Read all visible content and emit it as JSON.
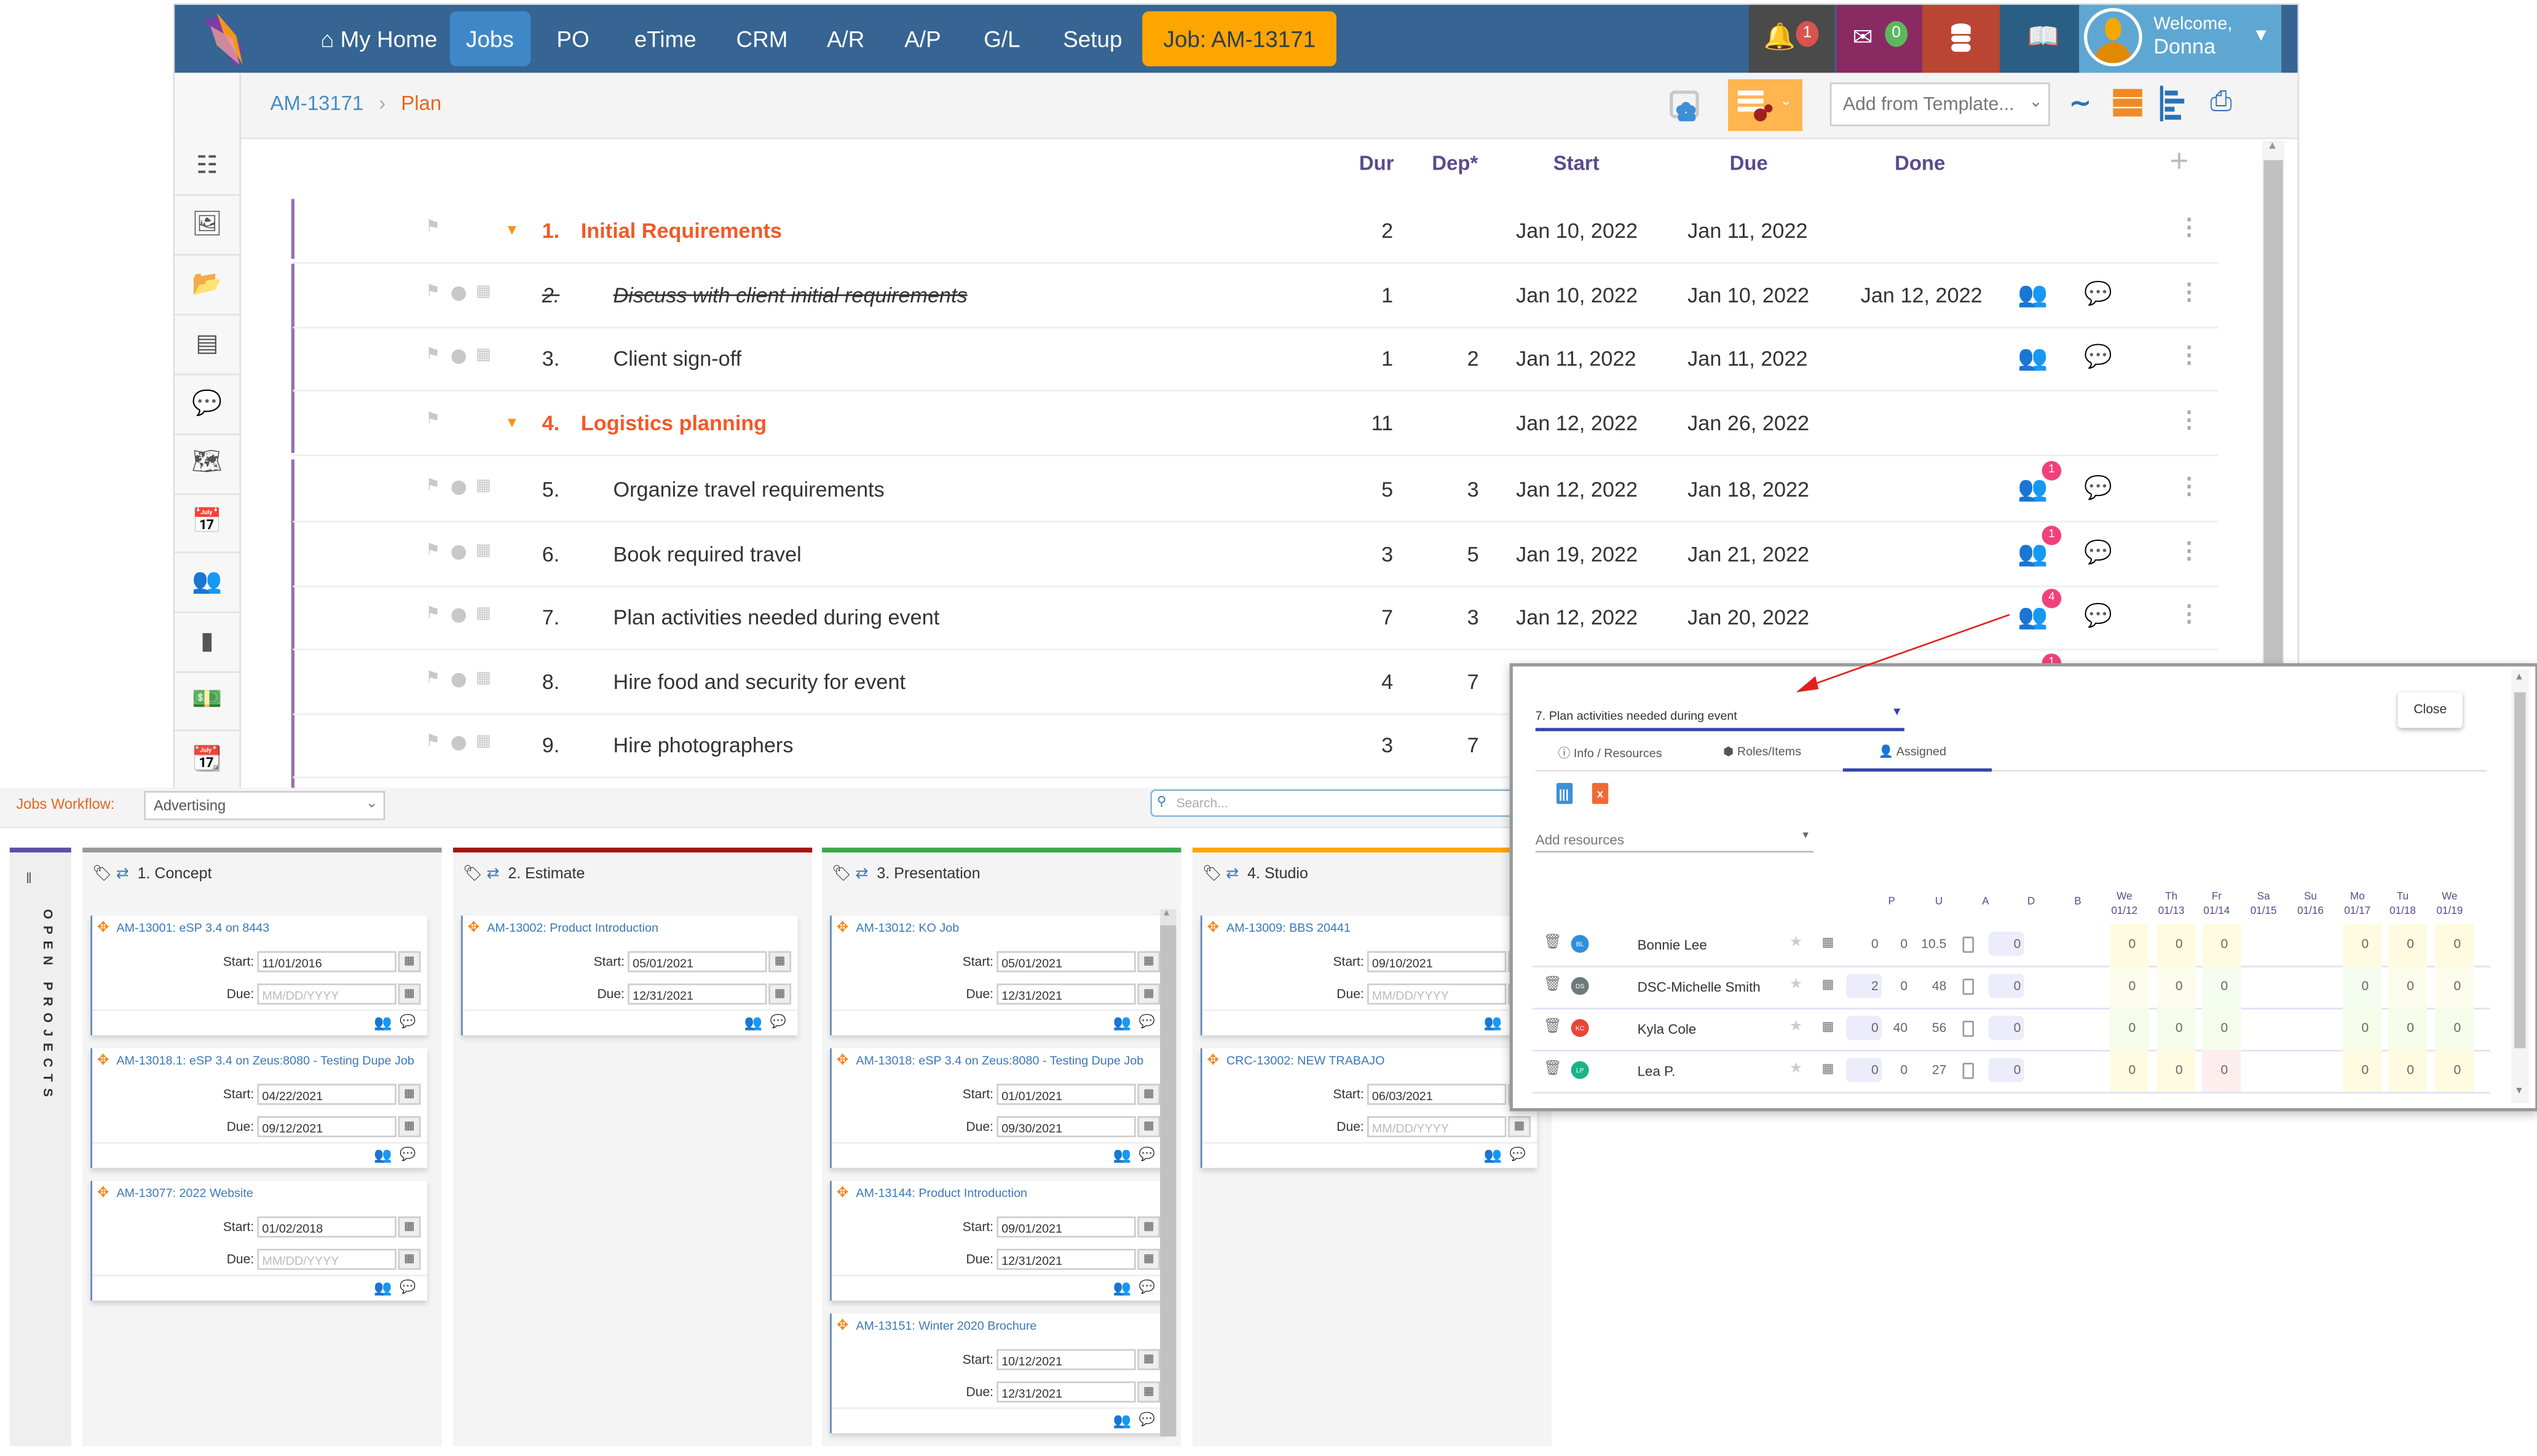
{
  "nav": {
    "items": [
      {
        "label": "My Home",
        "icon": "home-icon"
      },
      {
        "label": "Jobs",
        "active": true
      },
      {
        "label": "PO"
      },
      {
        "label": "eTime"
      },
      {
        "label": "CRM"
      },
      {
        "label": "A/R"
      },
      {
        "label": "A/P"
      },
      {
        "label": "G/L"
      },
      {
        "label": "Setup"
      }
    ],
    "job_button": "Job: AM-13171",
    "notifications_count": "1",
    "messages_count": "0",
    "welcome_line1": "Welcome,",
    "welcome_line2": "Donna",
    "colors": {
      "nav_bg": "#366493",
      "active": "#3f88c8",
      "job": "#ffa500",
      "bell_bg": "#4a4a4a",
      "mail_bg": "#8a2a62",
      "db_bg": "#b94532",
      "book_bg": "#2b5e85",
      "user_bg": "#5fa7d3"
    }
  },
  "breadcrumb": {
    "job": "AM-13171",
    "page": "Plan"
  },
  "toolbar": {
    "template_placeholder": "Add from Template..."
  },
  "plan": {
    "headers": {
      "dur": "Dur",
      "dep": "Dep*",
      "start": "Start",
      "due": "Due",
      "done": "Done"
    },
    "rows": [
      {
        "num": "1.",
        "name": "Initial Requirements",
        "group": true,
        "dur": "2",
        "dep": "",
        "start": "Jan 10, 2022",
        "due": "Jan 11, 2022",
        "done": "",
        "res_badge": "",
        "res_state": "none",
        "chat_state": "none"
      },
      {
        "num": "2.",
        "name": "Discuss with client initial requirements",
        "completed": true,
        "dur": "1",
        "dep": "",
        "start": "Jan 10, 2022",
        "due": "Jan 10, 2022",
        "done": "Jan 12, 2022",
        "res_badge": "",
        "res_state": "grey",
        "chat_state": "grey"
      },
      {
        "num": "3.",
        "name": "Client sign-off",
        "dur": "1",
        "dep": "2",
        "start": "Jan 11, 2022",
        "due": "Jan 11, 2022",
        "done": "",
        "res_badge": "",
        "res_state": "grey",
        "chat_state": "grey"
      },
      {
        "num": "4.",
        "name": "Logistics planning",
        "group": true,
        "dur": "11",
        "dep": "",
        "start": "Jan 12, 2022",
        "due": "Jan 26, 2022",
        "done": "",
        "res_badge": "",
        "res_state": "none",
        "chat_state": "none"
      },
      {
        "num": "5.",
        "name": "Organize travel requirements",
        "dur": "5",
        "dep": "3",
        "start": "Jan 12, 2022",
        "due": "Jan 18, 2022",
        "done": "",
        "res_badge": "1",
        "res_state": "green",
        "chat_state": "grey"
      },
      {
        "num": "6.",
        "name": "Book required travel",
        "dur": "3",
        "dep": "5",
        "start": "Jan 19, 2022",
        "due": "Jan 21, 2022",
        "done": "",
        "res_badge": "1",
        "res_state": "green",
        "chat_state": "grey"
      },
      {
        "num": "7.",
        "name": "Plan activities needed during event",
        "dur": "7",
        "dep": "3",
        "start": "Jan 12, 2022",
        "due": "Jan 20, 2022",
        "done": "",
        "res_badge": "4",
        "res_state": "green",
        "chat_state": "blue"
      },
      {
        "num": "8.",
        "name": "Hire food and security for event",
        "dur": "4",
        "dep": "7",
        "start": "",
        "due": "",
        "done": "",
        "res_badge": "1",
        "res_state": "green",
        "chat_state": "grey"
      },
      {
        "num": "9.",
        "name": "Hire photographers",
        "dur": "3",
        "dep": "7",
        "start": "",
        "due": "",
        "done": "",
        "res_badge": "",
        "res_state": "none",
        "chat_state": "none"
      }
    ]
  },
  "workflow": {
    "label": "Jobs Workflow:",
    "selected": "Advertising",
    "search_placeholder": "Search...",
    "side_label": "OPEN PROJECTS",
    "columns": [
      {
        "title": "1. Concept",
        "color": "#999999",
        "cards": [
          {
            "title": "AM-13001: eSP 3.4 on 8443",
            "start": "11/01/2016",
            "due": ""
          },
          {
            "title": "AM-13018.1: eSP 3.4 on Zeus:8080 - Testing Dupe Job",
            "start": "04/22/2021",
            "due": "09/12/2021"
          },
          {
            "title": "AM-13077: 2022 Website",
            "start": "01/02/2018",
            "due": ""
          }
        ]
      },
      {
        "title": "2. Estimate",
        "color": "#a31515",
        "cards": [
          {
            "title": "AM-13002: Product Introduction",
            "start": "05/01/2021",
            "due": "12/31/2021"
          }
        ]
      },
      {
        "title": "3. Presentation",
        "color": "#3aaa4a",
        "cards": [
          {
            "title": "AM-13012: KO Job",
            "start": "05/01/2021",
            "due": "12/31/2021"
          },
          {
            "title": "AM-13018: eSP 3.4 on Zeus:8080 - Testing Dupe Job",
            "start": "01/01/2021",
            "due": "09/30/2021"
          },
          {
            "title": "AM-13144: Product Introduction",
            "start": "09/01/2021",
            "due": "12/31/2021"
          },
          {
            "title": "AM-13151: Winter 2020 Brochure",
            "start": "10/12/2021",
            "due": "12/31/2021"
          }
        ]
      },
      {
        "title": "4. Studio",
        "color": "#ffa500",
        "cards": [
          {
            "title": "AM-13009: BBS 20441",
            "start": "09/10/2021",
            "due": ""
          },
          {
            "title": "CRC-13002: NEW TRABAJO",
            "start": "06/03/2021",
            "due": ""
          }
        ]
      }
    ],
    "start_label": "Start:",
    "due_label": "Due:",
    "date_placeholder": "MM/DD/YYYY"
  },
  "popup": {
    "task_select": "7. Plan activities needed during event",
    "close_label": "Close",
    "tabs": [
      {
        "label": "Info / Resources",
        "icon": "info-icon"
      },
      {
        "label": "Roles/Items",
        "icon": "cube-icon"
      },
      {
        "label": "Assigned",
        "icon": "user-assigned-icon",
        "active": true
      }
    ],
    "add_resources_placeholder": "Add resources",
    "columns": [
      "P",
      "U",
      "A",
      "D",
      "B"
    ],
    "days": [
      {
        "dow": "We",
        "date": "01/12"
      },
      {
        "dow": "Th",
        "date": "01/13"
      },
      {
        "dow": "Fr",
        "date": "01/14"
      },
      {
        "dow": "Sa",
        "date": "01/15"
      },
      {
        "dow": "Su",
        "date": "01/16"
      },
      {
        "dow": "Mo",
        "date": "01/17"
      },
      {
        "dow": "Tu",
        "date": "01/18"
      },
      {
        "dow": "We",
        "date": "01/19"
      }
    ],
    "resources": [
      {
        "initials": "BL",
        "name": "Bonnie Lee",
        "avatar_color": "#2f8fdc",
        "p": "0",
        "u": "0",
        "a": "10.5",
        "b": "0",
        "days": [
          "0",
          "0",
          "0",
          "",
          "",
          "0",
          "0",
          "0"
        ]
      },
      {
        "initials": "DS",
        "name": "DSC-Michelle Smith",
        "avatar_color": "#6c7b7b",
        "p": "2",
        "u": "0",
        "a": "48",
        "b": "0",
        "days": [
          "0",
          "0",
          "0",
          "",
          "",
          "0",
          "0",
          "0"
        ]
      },
      {
        "initials": "KC",
        "name": "Kyla Cole",
        "avatar_color": "#e8453c",
        "p": "0",
        "u": "40",
        "a": "56",
        "b": "0",
        "days": [
          "0",
          "0",
          "0",
          "",
          "",
          "0",
          "0",
          "0"
        ]
      },
      {
        "initials": "LP",
        "name": "Lea P.",
        "avatar_color": "#1bb38a",
        "p": "0",
        "u": "0",
        "a": "27",
        "b": "0",
        "days": [
          "0",
          "0",
          "0",
          "",
          "",
          "0",
          "0",
          "0"
        ]
      }
    ]
  }
}
